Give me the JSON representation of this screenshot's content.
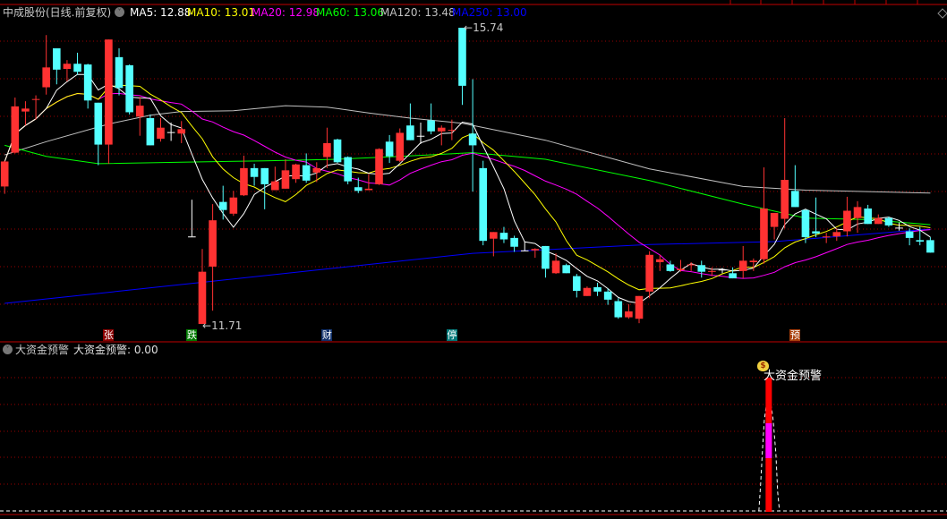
{
  "header": {
    "title": "中成股份(日线.前复权)",
    "ma": [
      {
        "label": "MA5: 12.88",
        "color": "#ffffff"
      },
      {
        "label": "MA10: 13.01",
        "color": "#ffff00"
      },
      {
        "label": "MA20: 12.98",
        "color": "#ff00ff"
      },
      {
        "label": "MA60: 13.06",
        "color": "#00ff00"
      },
      {
        "label": "MA120: 13.48",
        "color": "#c0c0c0"
      },
      {
        "label": "MA250: 13.00",
        "color": "#0000ff"
      }
    ]
  },
  "price_labels": {
    "high": "15.74",
    "low": "11.71"
  },
  "event_tags": [
    {
      "text": "张",
      "index": 10,
      "color": "#8b0000"
    },
    {
      "text": "跌",
      "index": 18,
      "color": "#007a00"
    },
    {
      "text": "财",
      "index": 31,
      "color": "#10306a"
    },
    {
      "text": "停",
      "index": 43,
      "color": "#007878"
    },
    {
      "text": "预",
      "index": 76,
      "color": "#a8400c"
    }
  ],
  "indicator": {
    "name": "大资金预警",
    "value_label": "大资金预警: 0.00",
    "signal_label": "大资金预警",
    "signal_index": 72
  },
  "colors": {
    "up": "#ff3232",
    "down": "#54ffff",
    "flat": "#ffffff",
    "grid": "#9a0000",
    "separator": "#c00000"
  },
  "chart_data": {
    "type": "candlestick",
    "ylim": [
      11.55,
      15.93
    ],
    "ohlc": [
      [
        13.58,
        13.93,
        13.48,
        13.92
      ],
      [
        14.04,
        14.79,
        14.03,
        14.67
      ],
      [
        14.6,
        14.74,
        14.41,
        14.64
      ],
      [
        14.76,
        14.82,
        14.49,
        14.77
      ],
      [
        14.93,
        15.64,
        14.83,
        15.2
      ],
      [
        15.46,
        15.46,
        14.97,
        15.17
      ],
      [
        15.18,
        15.3,
        15.01,
        15.25
      ],
      [
        15.25,
        15.4,
        15.1,
        15.14
      ],
      [
        15.24,
        15.25,
        14.64,
        14.75
      ],
      [
        14.72,
        14.72,
        13.87,
        14.15
      ],
      [
        14.15,
        15.58,
        13.89,
        15.58
      ],
      [
        15.34,
        15.46,
        14.82,
        14.92
      ],
      [
        15.23,
        15.24,
        14.56,
        14.59
      ],
      [
        14.53,
        14.8,
        14.27,
        14.68
      ],
      [
        14.51,
        14.56,
        14.14,
        14.14
      ],
      [
        14.23,
        14.51,
        14.19,
        14.38
      ],
      [
        14.32,
        14.45,
        14.2,
        14.32
      ],
      [
        14.3,
        14.47,
        14.17,
        14.36
      ],
      [
        12.9,
        13.4,
        12.9,
        12.9
      ],
      [
        11.71,
        12.73,
        11.71,
        12.42
      ],
      [
        12.49,
        13.34,
        11.89,
        13.12
      ],
      [
        13.37,
        13.59,
        13.13,
        13.26
      ],
      [
        13.21,
        13.52,
        13.18,
        13.43
      ],
      [
        13.46,
        14.0,
        13.45,
        13.83
      ],
      [
        13.83,
        13.89,
        13.59,
        13.71
      ],
      [
        13.83,
        13.83,
        13.27,
        13.61
      ],
      [
        13.53,
        13.85,
        13.53,
        13.65
      ],
      [
        13.55,
        13.95,
        13.55,
        13.8
      ],
      [
        13.68,
        13.89,
        13.63,
        13.88
      ],
      [
        13.87,
        14.03,
        13.63,
        13.66
      ],
      [
        13.77,
        13.91,
        13.64,
        13.83
      ],
      [
        13.98,
        14.38,
        13.83,
        14.17
      ],
      [
        14.22,
        14.23,
        13.9,
        13.91
      ],
      [
        13.98,
        13.99,
        13.61,
        13.65
      ],
      [
        13.57,
        13.7,
        13.49,
        13.52
      ],
      [
        13.53,
        13.75,
        13.53,
        13.55
      ],
      [
        13.61,
        14.1,
        13.6,
        14.09
      ],
      [
        14.19,
        14.28,
        13.9,
        13.99
      ],
      [
        13.93,
        14.37,
        13.91,
        14.31
      ],
      [
        14.41,
        14.71,
        14.21,
        14.21
      ],
      [
        14.27,
        14.45,
        14.16,
        14.27
      ],
      [
        14.48,
        14.71,
        14.29,
        14.33
      ],
      [
        14.33,
        14.41,
        14.14,
        14.38
      ],
      [
        14.34,
        14.49,
        14.21,
        14.35
      ],
      [
        15.74,
        15.74,
        14.69,
        14.95
      ],
      [
        14.3,
        15.04,
        13.51,
        14.14
      ],
      [
        13.83,
        13.93,
        12.78,
        12.84
      ],
      [
        12.87,
        12.96,
        12.63,
        12.96
      ],
      [
        12.95,
        13.03,
        12.81,
        12.86
      ],
      [
        12.88,
        12.91,
        12.69,
        12.76
      ],
      [
        12.71,
        12.83,
        12.7,
        12.71
      ],
      [
        12.71,
        12.74,
        12.61,
        12.73
      ],
      [
        12.77,
        12.77,
        12.34,
        12.46
      ],
      [
        12.4,
        12.67,
        12.39,
        12.57
      ],
      [
        12.51,
        12.53,
        12.4,
        12.4
      ],
      [
        12.36,
        12.39,
        12.07,
        12.16
      ],
      [
        12.09,
        12.22,
        12.09,
        12.2
      ],
      [
        12.21,
        12.27,
        12.09,
        12.15
      ],
      [
        12.15,
        12.19,
        11.97,
        12.04
      ],
      [
        12.02,
        12.06,
        11.78,
        11.8
      ],
      [
        11.8,
        11.98,
        11.78,
        11.88
      ],
      [
        11.78,
        12.09,
        11.72,
        12.09
      ],
      [
        12.15,
        12.7,
        12.06,
        12.65
      ],
      [
        12.55,
        12.65,
        12.43,
        12.59
      ],
      [
        12.52,
        12.57,
        12.42,
        12.43
      ],
      [
        12.44,
        12.58,
        12.42,
        12.46
      ],
      [
        12.51,
        12.55,
        12.43,
        12.52
      ],
      [
        12.51,
        12.57,
        12.34,
        12.42
      ],
      [
        12.42,
        12.48,
        12.36,
        12.43
      ],
      [
        12.45,
        12.47,
        12.4,
        12.45
      ],
      [
        12.4,
        12.48,
        12.33,
        12.33
      ],
      [
        12.43,
        12.77,
        12.33,
        12.57
      ],
      [
        12.55,
        12.6,
        12.43,
        12.57
      ],
      [
        12.59,
        13.84,
        12.53,
        13.28
      ],
      [
        13.03,
        13.22,
        12.86,
        13.22
      ],
      [
        13.14,
        14.51,
        13.01,
        13.67
      ],
      [
        13.52,
        13.87,
        13.3,
        13.3
      ],
      [
        13.26,
        13.26,
        12.81,
        12.89
      ],
      [
        12.97,
        13.43,
        12.89,
        12.94
      ],
      [
        12.89,
        12.95,
        12.81,
        12.9
      ],
      [
        12.9,
        13.01,
        12.84,
        12.96
      ],
      [
        12.97,
        13.44,
        12.9,
        13.25
      ],
      [
        13.15,
        13.38,
        12.95,
        13.3
      ],
      [
        13.28,
        13.33,
        13.07,
        13.07
      ],
      [
        13.07,
        13.2,
        13.07,
        13.15
      ],
      [
        13.15,
        13.17,
        13.03,
        13.05
      ],
      [
        13.02,
        13.09,
        12.98,
        13.02
      ],
      [
        12.97,
        13.01,
        12.78,
        12.88
      ],
      [
        12.85,
        13.03,
        12.78,
        12.83
      ],
      [
        12.85,
        12.89,
        12.68,
        12.68
      ]
    ],
    "ma_long": {
      "MA60": [
        [
          0,
          14.14
        ],
        [
          4,
          13.99
        ],
        [
          9,
          13.89
        ],
        [
          17,
          13.91
        ],
        [
          25,
          13.93
        ],
        [
          32,
          13.95
        ],
        [
          38,
          13.99
        ],
        [
          45,
          14.04
        ],
        [
          52,
          13.95
        ],
        [
          62,
          13.66
        ],
        [
          71,
          13.34
        ],
        [
          77,
          13.15
        ],
        [
          83,
          13.13
        ],
        [
          89,
          13.06
        ]
      ],
      "MA120": [
        [
          0,
          14.01
        ],
        [
          4,
          14.19
        ],
        [
          10,
          14.43
        ],
        [
          14,
          14.55
        ],
        [
          17,
          14.6
        ],
        [
          22,
          14.61
        ],
        [
          27,
          14.68
        ],
        [
          31,
          14.66
        ],
        [
          35,
          14.58
        ],
        [
          39,
          14.51
        ],
        [
          44,
          14.44
        ],
        [
          52,
          14.21
        ],
        [
          62,
          13.82
        ],
        [
          71,
          13.58
        ],
        [
          77,
          13.53
        ],
        [
          89,
          13.49
        ]
      ],
      "MA250": [
        [
          0,
          11.99
        ],
        [
          20,
          12.29
        ],
        [
          45,
          12.67
        ],
        [
          62,
          12.79
        ],
        [
          74,
          12.83
        ],
        [
          89,
          13.0
        ]
      ]
    },
    "indicator_series": {
      "signal_bar_index": 72,
      "value": 0.0
    }
  }
}
